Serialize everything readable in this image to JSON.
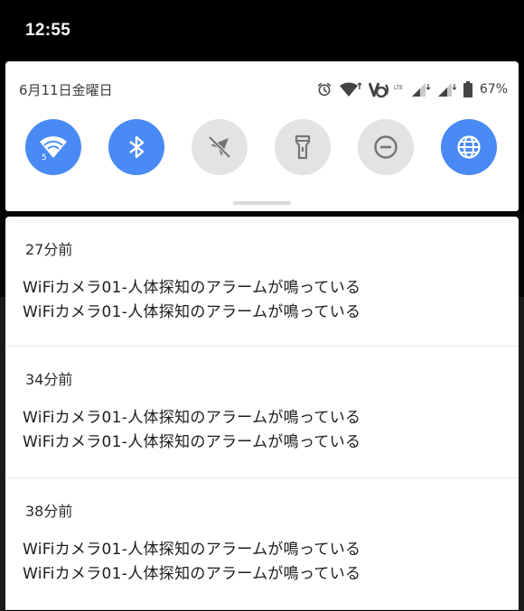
{
  "status_bar": {
    "time": "12:55"
  },
  "quick_settings": {
    "date": "6月11日金曜日",
    "battery_percent": "67%",
    "wifi_badge": "5",
    "wifi_signal_badge": "5",
    "lte_badge": "LTE",
    "tiles": [
      {
        "icon": "wifi-icon",
        "state": "on",
        "badge": "5"
      },
      {
        "icon": "bluetooth-icon",
        "state": "on"
      },
      {
        "icon": "location-off-icon",
        "state": "off"
      },
      {
        "icon": "flashlight-icon",
        "state": "off"
      },
      {
        "icon": "do-not-disturb-icon",
        "state": "off"
      },
      {
        "icon": "globe-icon",
        "state": "on"
      }
    ],
    "colors": {
      "accent": "#4a8af4",
      "tile_off": "#e3e3e3"
    }
  },
  "notifications": [
    {
      "time": "27分前",
      "line1": "WiFiカメラ01-人体探知のアラームが鳴っている",
      "line2": "WiFiカメラ01-人体探知のアラームが鳴っている"
    },
    {
      "time": "34分前",
      "line1": "WiFiカメラ01-人体探知のアラームが鳴っている",
      "line2": "WiFiカメラ01-人体探知のアラームが鳴っている"
    },
    {
      "time": "38分前",
      "line1": "WiFiカメラ01-人体探知のアラームが鳴っている",
      "line2": "WiFiカメラ01-人体探知のアラームが鳴っている"
    }
  ]
}
